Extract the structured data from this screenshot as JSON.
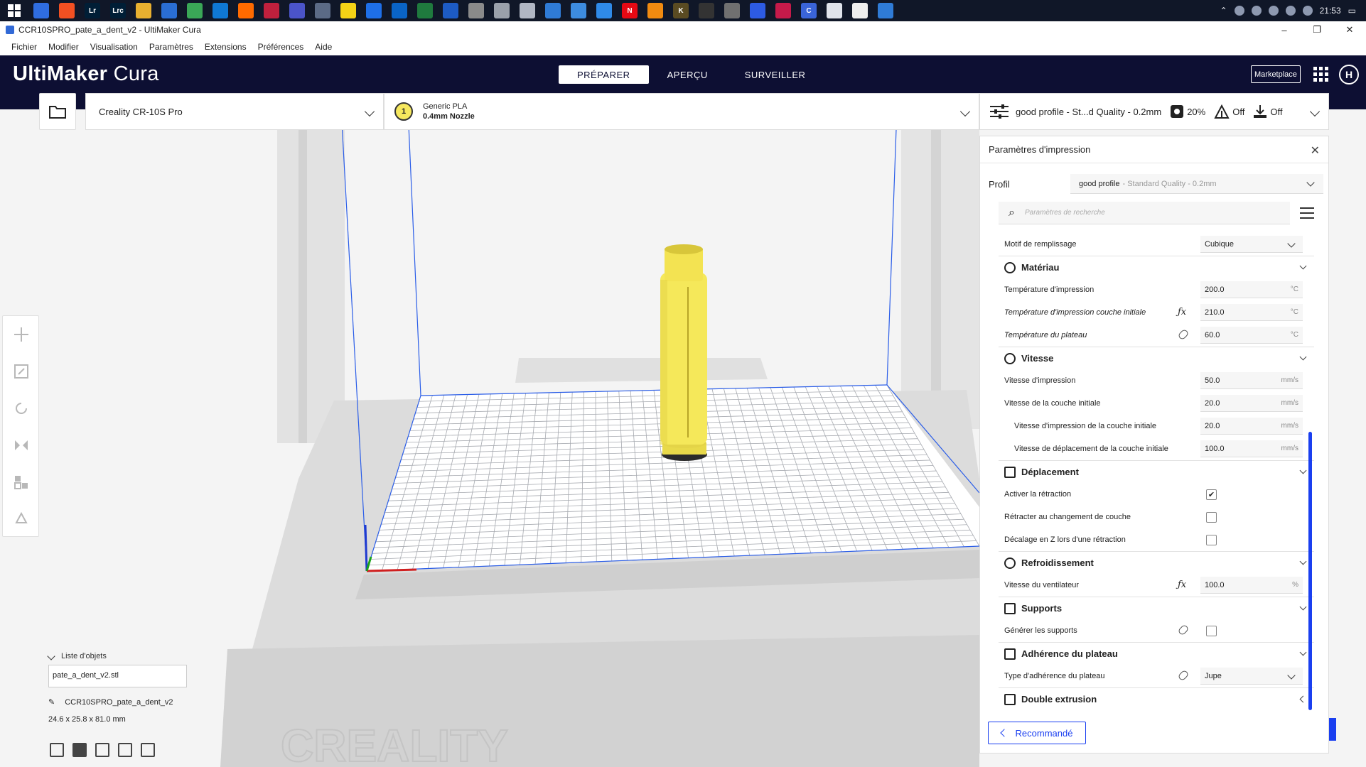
{
  "window": {
    "title": "CCR10SPRO_pate_a_dent_v2 - UltiMaker Cura",
    "minimize": "–",
    "maximize": "❐",
    "close": "✕"
  },
  "taskbar": {
    "apps": [
      {
        "label": "",
        "color": "#2f6de0"
      },
      {
        "label": "",
        "color": "#f25022"
      },
      {
        "label": "Lr",
        "color": "#001e36"
      },
      {
        "label": "Lrc",
        "color": "#001e36"
      },
      {
        "label": "",
        "color": "#e8b030"
      },
      {
        "label": "",
        "color": "#2a6ed4"
      },
      {
        "label": "",
        "color": "#3aa757"
      },
      {
        "label": "",
        "color": "#0f78d4"
      },
      {
        "label": "",
        "color": "#ff6a00"
      },
      {
        "label": "",
        "color": "#c0203d"
      },
      {
        "label": "",
        "color": "#4b54c9"
      },
      {
        "label": "",
        "color": "#5b6a86"
      },
      {
        "label": "",
        "color": "#f4d216"
      },
      {
        "label": "",
        "color": "#1e6fe8"
      },
      {
        "label": "",
        "color": "#0a64c7"
      },
      {
        "label": "",
        "color": "#1f7a3e"
      },
      {
        "label": "",
        "color": "#1d5bc4"
      },
      {
        "label": "",
        "color": "#8a8a8a"
      },
      {
        "label": "",
        "color": "#9aa0aa"
      },
      {
        "label": "",
        "color": "#b0b6c4"
      },
      {
        "label": "",
        "color": "#2f7bd6"
      },
      {
        "label": "",
        "color": "#3d8ce0"
      },
      {
        "label": "",
        "color": "#2f8ae8"
      },
      {
        "label": "N",
        "color": "#e50914"
      },
      {
        "label": "",
        "color": "#f08a10"
      },
      {
        "label": "K",
        "color": "#5a4b22"
      },
      {
        "label": "",
        "color": "#333333"
      },
      {
        "label": "",
        "color": "#707070"
      },
      {
        "label": "",
        "color": "#2d5be3"
      },
      {
        "label": "",
        "color": "#c51a4a"
      },
      {
        "label": "C",
        "color": "#3a64d8"
      },
      {
        "label": "",
        "color": "#e0e4ec"
      },
      {
        "label": "",
        "color": "#eeeeee"
      },
      {
        "label": "",
        "color": "#2f7bd6"
      }
    ],
    "clock": "21:53"
  },
  "menubar": {
    "items": [
      "Fichier",
      "Modifier",
      "Visualisation",
      "Paramètres",
      "Extensions",
      "Préférences",
      "Aide"
    ]
  },
  "header": {
    "logo_bold": "UltiMaker",
    "logo_light": " Cura",
    "tabs": [
      {
        "label": "PRÉPARER",
        "active": true
      },
      {
        "label": "APERÇU",
        "active": false
      },
      {
        "label": "SURVEILLER",
        "active": false
      }
    ],
    "marketplace": "Marketplace",
    "account_initial": "H"
  },
  "toolbar": {
    "printer": "Creality CR-10S Pro",
    "material_name": "Generic PLA",
    "nozzle": "0.4mm Nozzle",
    "extruder_number": "1",
    "profile_summary": "good profile - St...d Quality - 0.2mm",
    "infill": "20%",
    "support": "Off",
    "adhesion": "Off"
  },
  "objects": {
    "header": "Liste d'objets",
    "file": "pate_a_dent_v2.stl",
    "name": "CCR10SPRO_pate_a_dent_v2",
    "dimensions": "24.6 x 25.8 x 81.0 mm"
  },
  "viewport": {
    "brand": "CREALITY",
    "model_color": "#f5e85a",
    "grid_line": "#9aa0a8",
    "volume_edge": "#2a5de8"
  },
  "panel": {
    "title": "Paramètres d'impression",
    "close": "✕",
    "profile_label": "Profil",
    "profile_name": "good profile",
    "profile_sub": "- Standard Quality - 0.2mm",
    "search_placeholder": "Paramètres de recherche",
    "infill_pattern_label": "Motif de remplissage",
    "infill_pattern_value": "Cubique",
    "material": {
      "title": "Matériau",
      "print_temp_label": "Température d'impression",
      "print_temp": "200.0",
      "initial_temp_label": "Température d'impression couche initiale",
      "initial_temp": "210.0",
      "bed_temp_label": "Température du plateau",
      "bed_temp": "60.0",
      "unit": "°C"
    },
    "speed": {
      "title": "Vitesse",
      "print_speed_label": "Vitesse d'impression",
      "print_speed": "50.0",
      "initial_layer_label": "Vitesse de la couche initiale",
      "initial_layer": "20.0",
      "initial_print_label": "Vitesse d'impression de la couche initiale",
      "initial_print": "20.0",
      "initial_travel_label": "Vitesse de déplacement de la couche initiale",
      "initial_travel": "100.0",
      "unit": "mm/s"
    },
    "travel": {
      "title": "Déplacement",
      "retraction_label": "Activer la rétraction",
      "retraction_checked": "✔",
      "retract_layer_label": "Rétracter au changement de couche",
      "zhop_label": "Décalage en Z lors d'une rétraction"
    },
    "cooling": {
      "title": "Refroidissement",
      "fan_label": "Vitesse du ventilateur",
      "fan_value": "100.0",
      "unit": "%"
    },
    "supports": {
      "title": "Supports",
      "generate_label": "Générer les supports"
    },
    "adhesion": {
      "title": "Adhérence du plateau",
      "type_label": "Type d'adhérence du plateau",
      "type_value": "Jupe"
    },
    "dual": {
      "title": "Double extrusion"
    },
    "recommended": "Recommandé"
  }
}
